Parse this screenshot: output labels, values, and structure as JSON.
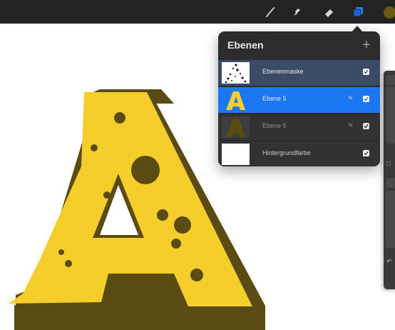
{
  "toolbar": {
    "tools": [
      {
        "icon": "brush-icon",
        "active": false
      },
      {
        "icon": "smudge-icon",
        "active": false
      },
      {
        "icon": "eraser-icon",
        "active": false
      },
      {
        "icon": "layers-icon",
        "active": true
      }
    ],
    "active_color": "#6b5a12"
  },
  "layers_panel": {
    "title": "Ebenen",
    "add_label": "+",
    "layers": [
      {
        "name": "Ebenenmaske",
        "blend": "",
        "visible": true,
        "state": "mask"
      },
      {
        "name": "Ebene 5",
        "blend": "N",
        "visible": true,
        "state": "selected"
      },
      {
        "name": "Ebene 5",
        "blend": "N",
        "visible": true,
        "state": "normal"
      },
      {
        "name": "Hintergrundfarbe",
        "blend": "",
        "visible": true,
        "state": "background"
      }
    ]
  },
  "colors": {
    "toolbar_bg": "#232325",
    "panel_bg": "#2c2c2e",
    "selected_layer": "#1b78f2",
    "letter_fill": "#f6ce2c",
    "letter_shadow": "#5a4b12"
  }
}
